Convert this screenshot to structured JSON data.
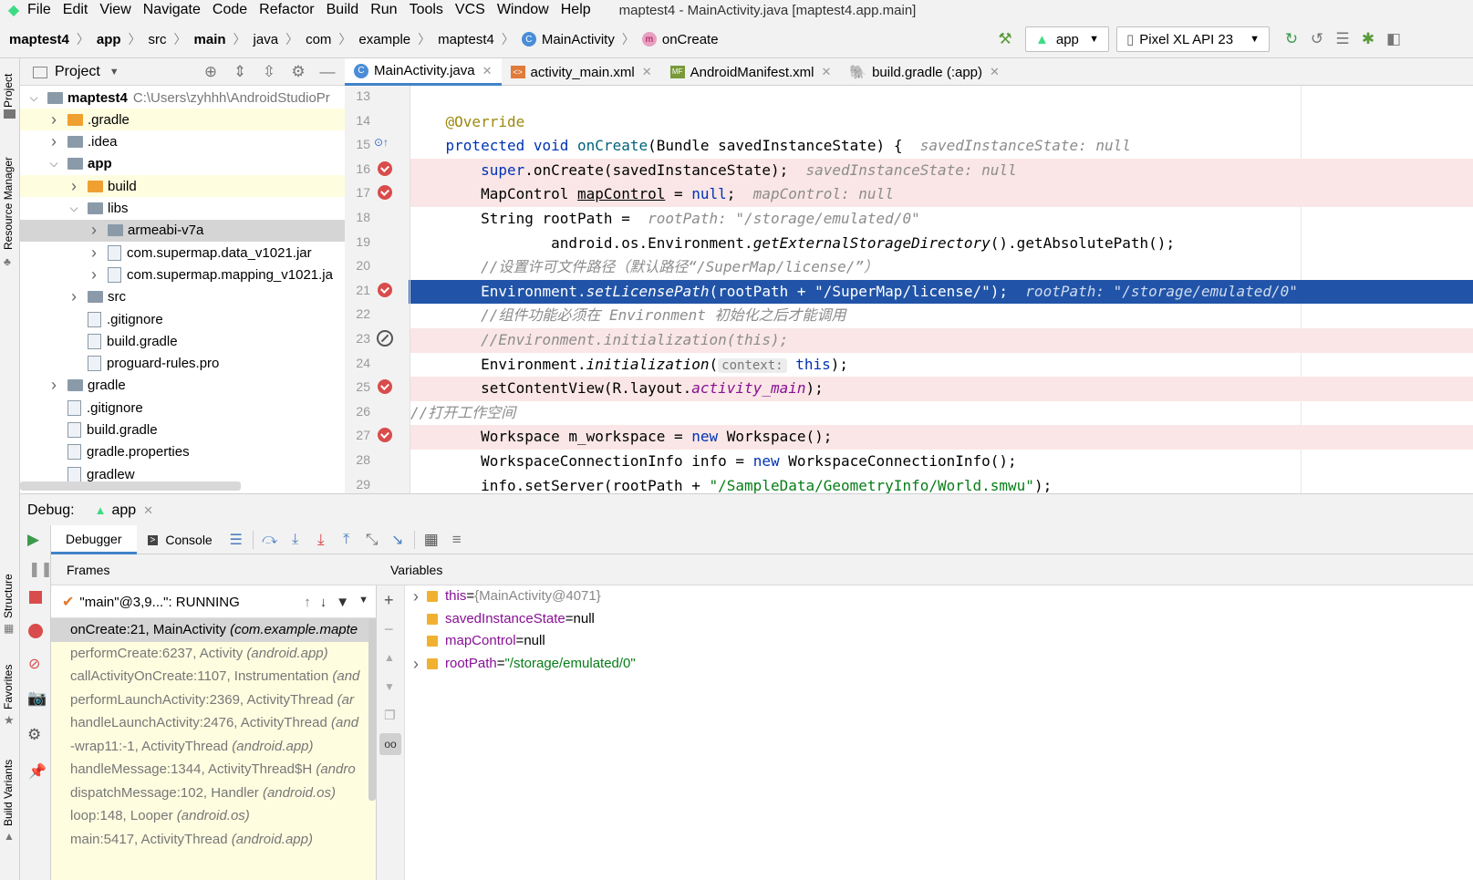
{
  "menu": {
    "items": [
      "File",
      "Edit",
      "View",
      "Navigate",
      "Code",
      "Refactor",
      "Build",
      "Run",
      "Tools",
      "VCS",
      "Window",
      "Help"
    ],
    "window_title": "maptest4 - MainActivity.java [maptest4.app.main]"
  },
  "breadcrumb": [
    "maptest4",
    "app",
    "src",
    "main",
    "java",
    "com",
    "example",
    "maptest4",
    "MainActivity",
    "onCreate"
  ],
  "toolbar": {
    "run_config": "app",
    "device": "Pixel XL API 23"
  },
  "side_stripe": {
    "project": "Project",
    "resource_manager": "Resource Manager",
    "structure": "Structure",
    "favorites": "Favorites",
    "build_variants": "Build Variants"
  },
  "project_panel": {
    "title": "Project",
    "tree": [
      {
        "label": "maptest4",
        "path": "C:\\Users\\zyhhh\\AndroidStudioPr",
        "indent": 0,
        "arrow": "down",
        "icon": "folder-gray"
      },
      {
        "label": ".gradle",
        "indent": 1,
        "arrow": "right",
        "icon": "folder-orange",
        "hl": true
      },
      {
        "label": ".idea",
        "indent": 1,
        "arrow": "right",
        "icon": "folder-gray"
      },
      {
        "label": "app",
        "indent": 1,
        "arrow": "down",
        "icon": "folder-gray",
        "bold": true
      },
      {
        "label": "build",
        "indent": 2,
        "arrow": "right",
        "icon": "folder-orange",
        "hl": true
      },
      {
        "label": "libs",
        "indent": 2,
        "arrow": "down",
        "icon": "folder-gray"
      },
      {
        "label": "armeabi-v7a",
        "indent": 3,
        "arrow": "right",
        "icon": "folder-gray",
        "sel": true
      },
      {
        "label": "com.supermap.data_v1021.jar",
        "indent": 3,
        "arrow": "right",
        "icon": "file"
      },
      {
        "label": "com.supermap.mapping_v1021.ja",
        "indent": 3,
        "arrow": "right",
        "icon": "file"
      },
      {
        "label": "src",
        "indent": 2,
        "arrow": "right",
        "icon": "folder-gray"
      },
      {
        "label": ".gitignore",
        "indent": 2,
        "arrow": "",
        "icon": "file"
      },
      {
        "label": "build.gradle",
        "indent": 2,
        "arrow": "",
        "icon": "file"
      },
      {
        "label": "proguard-rules.pro",
        "indent": 2,
        "arrow": "",
        "icon": "file"
      },
      {
        "label": "gradle",
        "indent": 1,
        "arrow": "right",
        "icon": "folder-gray"
      },
      {
        "label": ".gitignore",
        "indent": 1,
        "arrow": "",
        "icon": "file"
      },
      {
        "label": "build.gradle",
        "indent": 1,
        "arrow": "",
        "icon": "file"
      },
      {
        "label": "gradle.properties",
        "indent": 1,
        "arrow": "",
        "icon": "file"
      },
      {
        "label": "gradlew",
        "indent": 1,
        "arrow": "",
        "icon": "file"
      }
    ]
  },
  "editor": {
    "tabs": [
      {
        "label": "MainActivity.java",
        "active": true
      },
      {
        "label": "activity_main.xml",
        "active": false
      },
      {
        "label": "AndroidManifest.xml",
        "active": false
      },
      {
        "label": "build.gradle (:app)",
        "active": false
      }
    ],
    "line_numbers": [
      "13",
      "14",
      "15",
      "16",
      "17",
      "18",
      "19",
      "20",
      "21",
      "22",
      "23",
      "24",
      "25",
      "26",
      "27",
      "28",
      "29"
    ],
    "code": {
      "l14": "@Override",
      "l15_kw": "protected void ",
      "l15_fn": "onCreate",
      "l15_rest": "(Bundle savedInstanceState) {",
      "l15_hint": "savedInstanceState: null",
      "l16_kw": "super",
      "l16_rest": ".onCreate(savedInstanceState);",
      "l16_hint": "savedInstanceState: null",
      "l17_a": "MapControl ",
      "l17_b": "mapControl",
      "l17_c": " = ",
      "l17_kw": "null",
      "l17_d": ";",
      "l17_hint": "mapControl: null",
      "l18": "String rootPath = ",
      "l18_hint": "rootPath: \"/storage/emulated/0\"",
      "l19_a": "android.os.Environment.",
      "l19_b": "getExternalStorageDirectory",
      "l19_c": "().getAbsolutePath();",
      "l20": "//设置许可文件路径（默认路径“/SuperMap/license/”）",
      "l21_a": "Environment.",
      "l21_b": "setLicensePath",
      "l21_c": "(rootPath + ",
      "l21_str": "\"/SuperMap/license/\"",
      "l21_d": ");",
      "l21_hint": "rootPath: \"/storage/emulated/0\"",
      "l22": "//组件功能必须在 Environment 初始化之后才能调用",
      "l23": "//Environment.initialization(this);",
      "l24_a": "Environment.",
      "l24_b": "initialization",
      "l24_c": "(",
      "l24_ph": "context:",
      "l24_kw": "this",
      "l24_d": ");",
      "l25_a": "setContentView(R.layout.",
      "l25_b": "activity_main",
      "l25_c": ");",
      "l26": "//打开工作空间",
      "l27_a": "Workspace m_workspace = ",
      "l27_kw": "new",
      "l27_b": " Workspace();",
      "l28_a": "WorkspaceConnectionInfo info = ",
      "l28_kw": "new",
      "l28_b": " WorkspaceConnectionInfo();",
      "l29_a": "info.setServer(rootPath + ",
      "l29_str": "\"/SampleData/GeometryInfo/World.smwu\"",
      "l29_b": ");"
    }
  },
  "debug": {
    "title": "Debug:",
    "session": "app",
    "tabs": {
      "debugger": "Debugger",
      "console": "Console"
    },
    "frames_title": "Frames",
    "variables_title": "Variables",
    "thread": "\"main\"@3,9...\": RUNNING",
    "frames": [
      {
        "method": "onCreate:21, MainActivity ",
        "pkg": "(com.example.mapte",
        "sel": true
      },
      {
        "method": "performCreate:6237, Activity ",
        "pkg": "(android.app)"
      },
      {
        "method": "callActivityOnCreate:1107, Instrumentation ",
        "pkg": "(and"
      },
      {
        "method": "performLaunchActivity:2369, ActivityThread ",
        "pkg": "(ar"
      },
      {
        "method": "handleLaunchActivity:2476, ActivityThread ",
        "pkg": "(and"
      },
      {
        "method": "-wrap11:-1, ActivityThread ",
        "pkg": "(android.app)"
      },
      {
        "method": "handleMessage:1344, ActivityThread$H ",
        "pkg": "(andro"
      },
      {
        "method": "dispatchMessage:102, Handler ",
        "pkg": "(android.os)"
      },
      {
        "method": "loop:148, Looper ",
        "pkg": "(android.os)"
      },
      {
        "method": "main:5417, ActivityThread ",
        "pkg": "(android.app)"
      }
    ],
    "variables": [
      {
        "name": "this",
        "eq": " = ",
        "value": "{MainActivity@4071}",
        "kind": "obj",
        "expand": true
      },
      {
        "name": "savedInstanceState",
        "eq": " = ",
        "value": "null",
        "kind": "plain",
        "expand": false
      },
      {
        "name": "mapControl",
        "eq": " = ",
        "value": "null",
        "kind": "plain",
        "expand": false
      },
      {
        "name": "rootPath",
        "eq": " = ",
        "value": "\"/storage/emulated/0\"",
        "kind": "str",
        "expand": true
      }
    ]
  }
}
